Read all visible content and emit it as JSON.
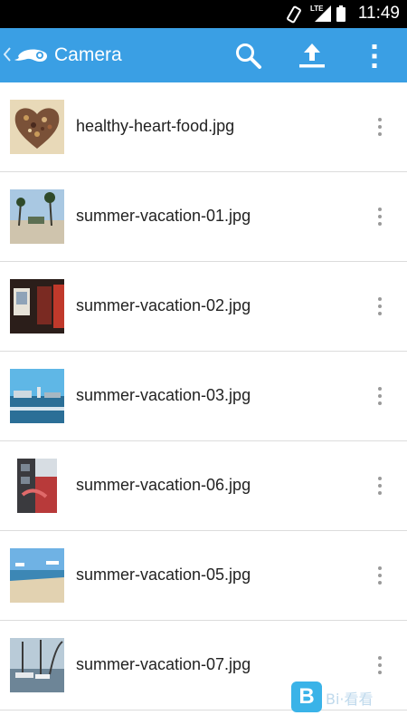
{
  "status_bar": {
    "network": "LTE",
    "time": "11:49"
  },
  "app_bar": {
    "title": "Camera",
    "background_color": "#3a9fe4",
    "icons": [
      "back-icon",
      "app-logo",
      "search-icon",
      "upload-icon",
      "overflow-menu-icon"
    ]
  },
  "files": [
    {
      "name": "healthy-heart-food.jpg",
      "thumbnail": "heart-shaped food photo"
    },
    {
      "name": "summer-vacation-01.jpg",
      "thumbnail": "palm trees beach photo"
    },
    {
      "name": "summer-vacation-02.jpg",
      "thumbnail": "street poster photo"
    },
    {
      "name": "summer-vacation-03.jpg",
      "thumbnail": "harbor skyline photo"
    },
    {
      "name": "summer-vacation-06.jpg",
      "thumbnail": "red building photo"
    },
    {
      "name": "summer-vacation-05.jpg",
      "thumbnail": "sandy beach photo"
    },
    {
      "name": "summer-vacation-07.jpg",
      "thumbnail": "marina boats photo"
    }
  ],
  "watermark": {
    "logo_letter": "B",
    "text": "Bi·看看"
  }
}
